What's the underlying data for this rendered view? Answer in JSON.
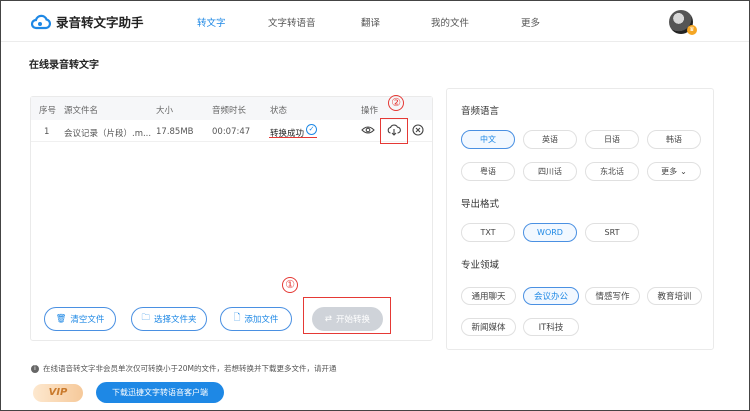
{
  "app": {
    "title": "录音转文字助手"
  },
  "nav": [
    {
      "label": "转文字",
      "active": true
    },
    {
      "label": "文字转语音"
    },
    {
      "label": "翻译"
    },
    {
      "label": "我的文件"
    },
    {
      "label": "更多"
    }
  ],
  "page_title": "在线录音转文字",
  "table": {
    "headers": [
      "序号",
      "源文件名",
      "大小",
      "音频时长",
      "状态",
      "操作"
    ],
    "rows": [
      {
        "index": "1",
        "name": "会议记录（片段）.m...",
        "size": "17.85MB",
        "duration": "00:07:47",
        "status": "转换成功"
      }
    ]
  },
  "annotations": {
    "one": "①",
    "two": "②"
  },
  "buttons": {
    "clear": "清空文件",
    "choose_folder": "选择文件夹",
    "add_file": "添加文件",
    "start": "开始转换"
  },
  "settings": {
    "language": {
      "title": "音频语言",
      "options": [
        "中文",
        "英语",
        "日语",
        "韩语",
        "粤语",
        "四川话",
        "东北话",
        "更多"
      ],
      "selected": "中文"
    },
    "export": {
      "title": "导出格式",
      "options": [
        "TXT",
        "WORD",
        "SRT"
      ],
      "selected": "WORD"
    },
    "domain": {
      "title": "专业领域",
      "options": [
        "通用聊天",
        "会议办公",
        "情感写作",
        "教育培训",
        "新闻媒体",
        "IT科技"
      ],
      "selected": "会议办公"
    }
  },
  "notice": "在线语音转文字非会员单次仅可转换小于20M的文件，若想转换并下载更多文件，请开通",
  "vip_label": "VIP",
  "download_client": "下载迅捷文字转语音客户端",
  "colors": {
    "accent": "#1e88e5",
    "annotation": "#e53935",
    "disabled": "#cfd3d9"
  }
}
